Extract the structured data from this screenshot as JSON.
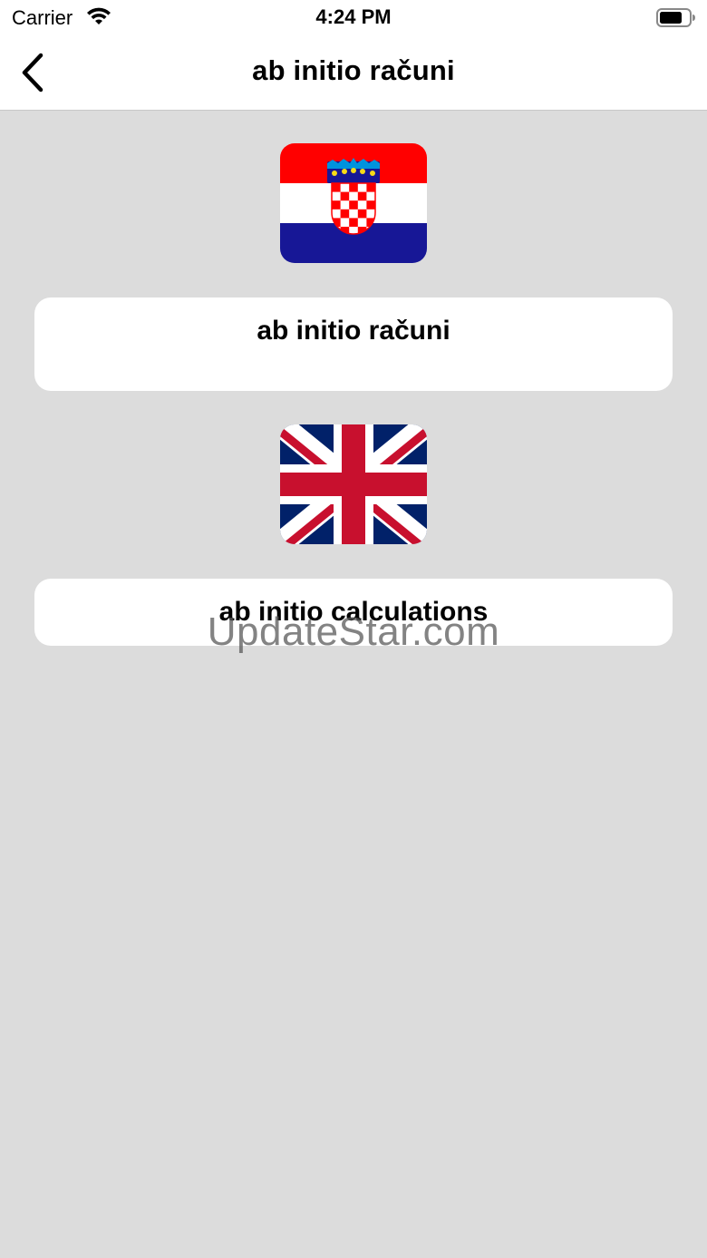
{
  "status_bar": {
    "carrier": "Carrier",
    "time": "4:24 PM"
  },
  "nav": {
    "title": "ab initio računi",
    "back_icon": "chevron-left-icon"
  },
  "languages": [
    {
      "flag": "croatia-flag",
      "label": "ab initio računi"
    },
    {
      "flag": "uk-flag",
      "label": "ab initio calculations"
    }
  ],
  "watermark": "UpdateStar.com",
  "colors": {
    "background": "#dcdcdc",
    "card": "#ffffff",
    "croatia_red": "#ff0000",
    "croatia_blue": "#171796",
    "uk_blue": "#012169",
    "uk_red": "#c8102e"
  }
}
